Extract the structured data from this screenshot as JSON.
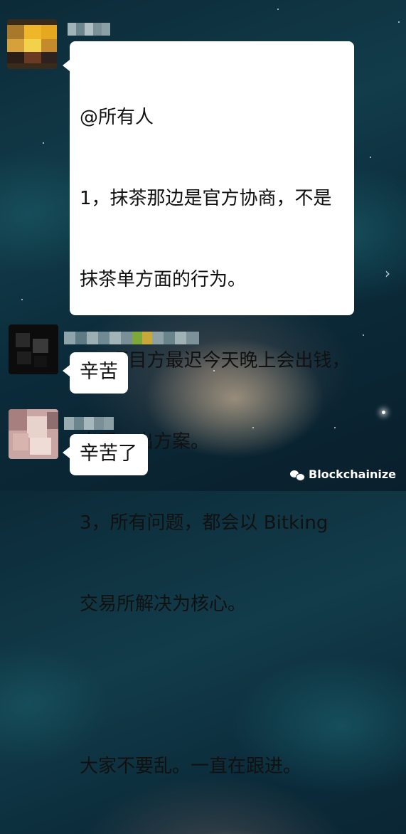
{
  "messages": [
    {
      "lines": [
        "@所有人",
        "1，抹茶那边是官方协商，不是",
        "抹茶单方面的行为。",
        "2，项目方最迟今天晚上会出钱，",
        "出币，出方案。",
        "3，所有问题，都会以 Bitking",
        "交易所解决为核心。",
        "",
        "大家不要乱。一直在跟进。"
      ]
    },
    {
      "text": "辛苦"
    },
    {
      "text": "辛苦了"
    }
  ],
  "watermark": {
    "text": "Blockchainize",
    "icon": "wechat-icon"
  },
  "navigation": {
    "icon": "chevron-right-icon",
    "glyph": "›"
  },
  "colors": {
    "bubble": "#ffffff",
    "text": "#111111"
  }
}
